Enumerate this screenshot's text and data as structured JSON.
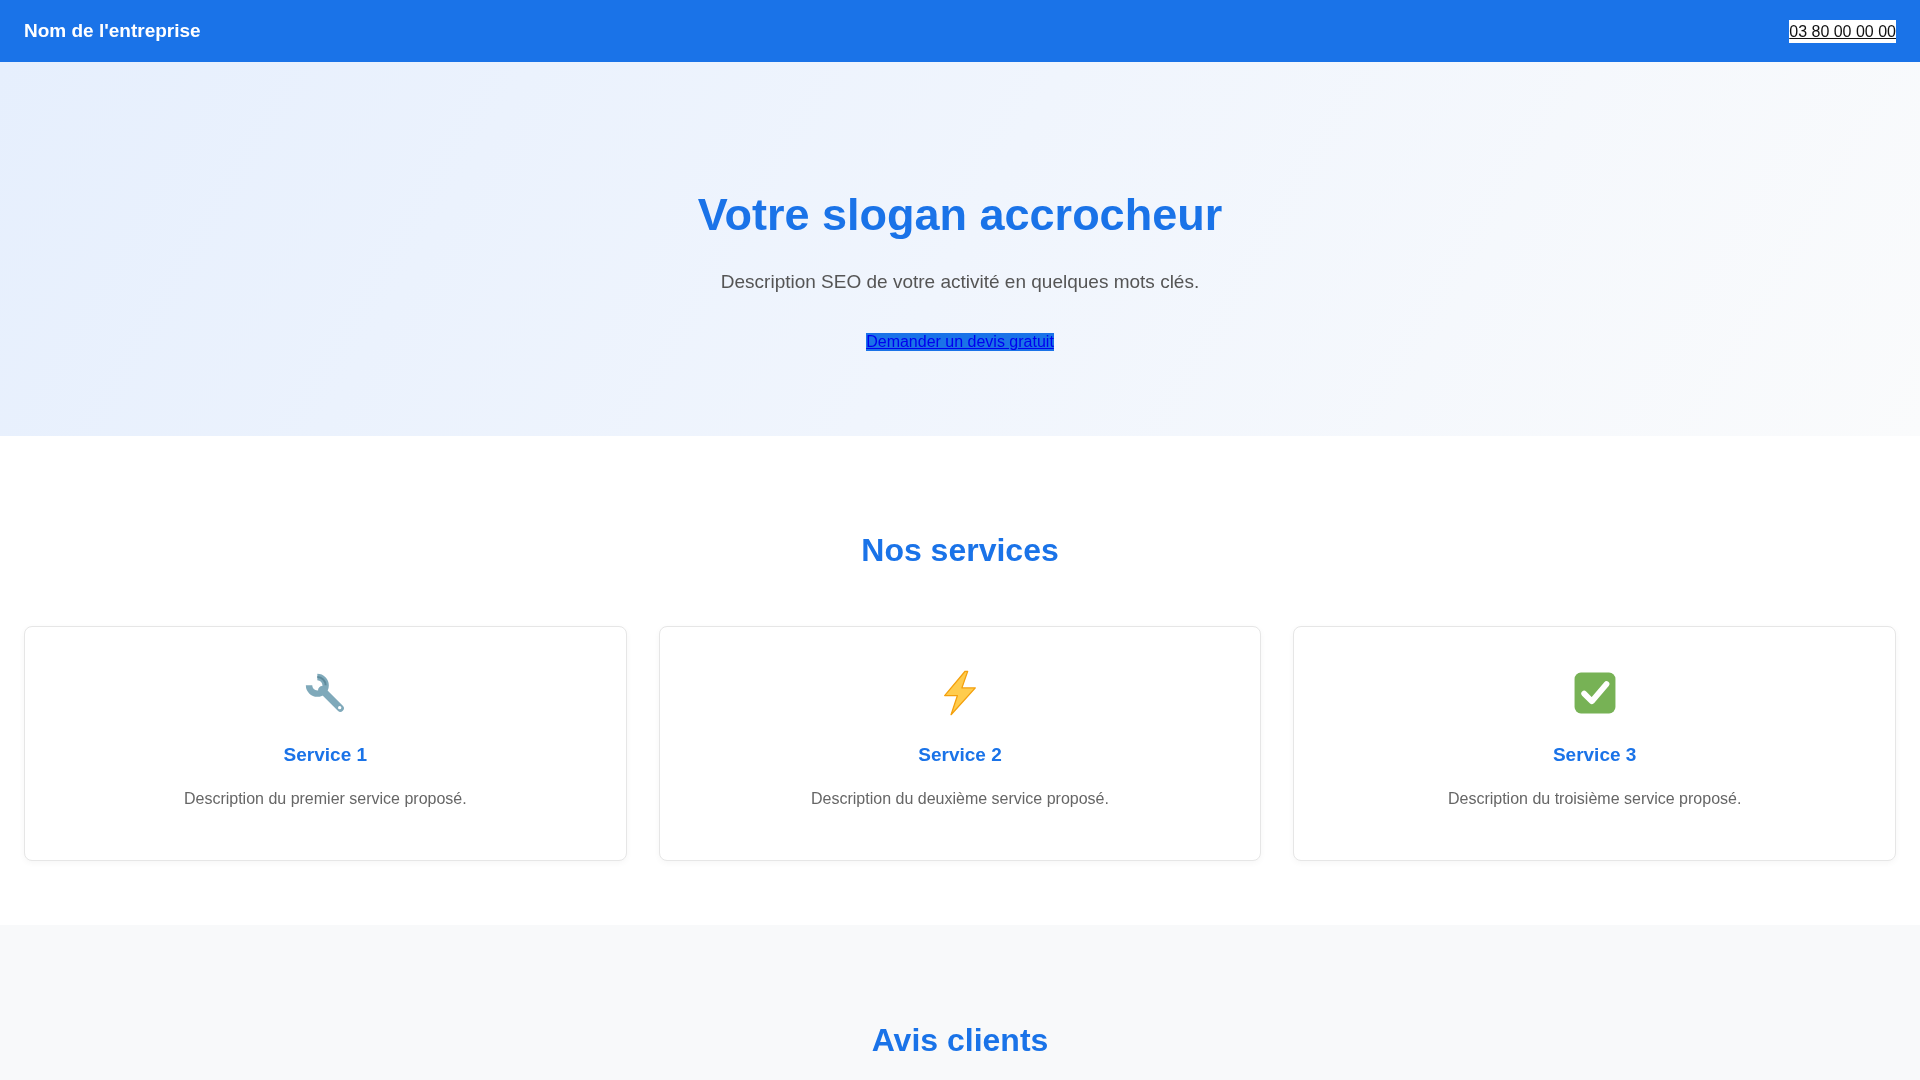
{
  "header": {
    "company_name": "Nom de l'entreprise",
    "phone": "03 80 00 00 00"
  },
  "hero": {
    "title": "Votre slogan accrocheur",
    "description": "Description SEO de votre activité en quelques mots clés.",
    "cta": "Demander un devis gratuit"
  },
  "services": {
    "title": "Nos services",
    "items": [
      {
        "title": "Service 1",
        "description": "Description du premier service proposé."
      },
      {
        "title": "Service 2",
        "description": "Description du deuxième service proposé."
      },
      {
        "title": "Service 3",
        "description": "Description du troisième service proposé."
      }
    ]
  },
  "reviews": {
    "title": "Avis clients"
  }
}
